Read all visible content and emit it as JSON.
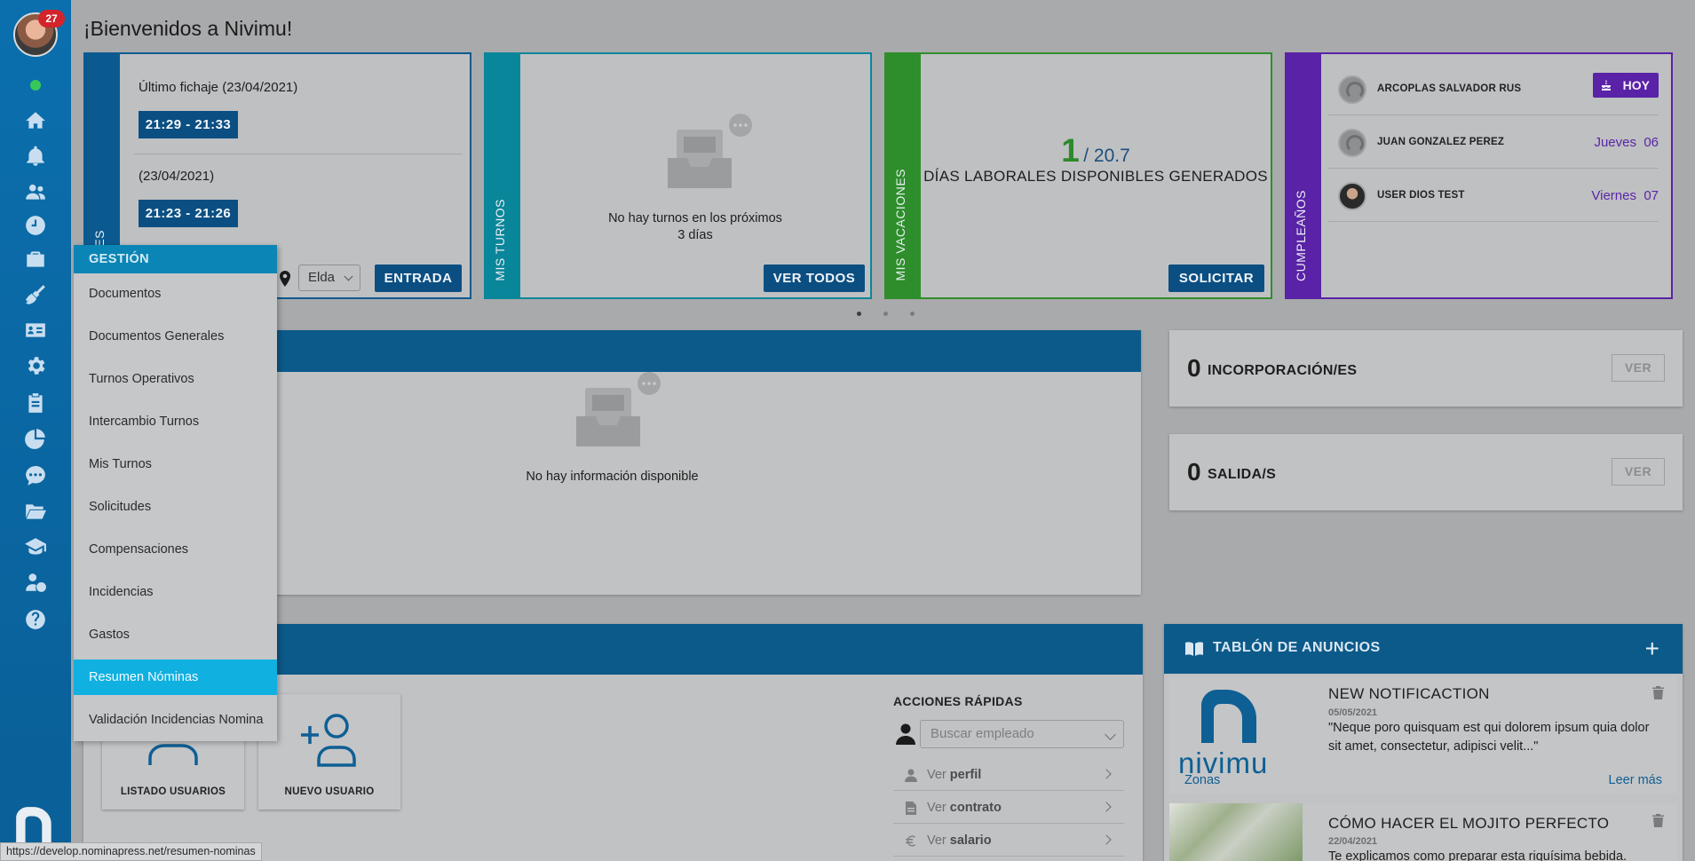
{
  "user": {
    "notification_count": "27"
  },
  "header": {
    "welcome": "¡Bienvenidos a Nivimu!"
  },
  "rail": {
    "icons": [
      "home-icon",
      "bell-icon",
      "users-icon",
      "clock-icon",
      "briefcase-icon",
      "broom-icon",
      "id-card-icon",
      "gear-icon",
      "clipboard-icon",
      "pie-chart-icon",
      "chat-icon",
      "folder-icon",
      "graduation-cap-icon",
      "user-salary-icon",
      "help-icon"
    ]
  },
  "fichajes": {
    "strip_label": "CHAJES",
    "entries": [
      {
        "title": "Último fichaje (23/04/2021)",
        "time": "21:29 - 21:33"
      },
      {
        "title": "(23/04/2021)",
        "time": "21:23 - 21:26"
      }
    ],
    "location": "Elda",
    "entry_button": "ENTRADA"
  },
  "turnos": {
    "strip_label": "MIS TURNOS",
    "empty_line1": "No hay turnos en los próximos",
    "empty_line2": "3 días",
    "button": "VER TODOS"
  },
  "vacaciones": {
    "strip_label": "MIS VACACIONES",
    "available": "1",
    "total": "/ 20.7",
    "label": "DÍAS LABORALES DISPONIBLES GENERADOS",
    "button": "SOLICITAR"
  },
  "cumpleanos": {
    "strip_label": "CUMPLEAÑOS",
    "rows": [
      {
        "name": "ARCOPLAS SALVADOR RUS",
        "date": "HOY"
      },
      {
        "name": "JUAN GONZALEZ PEREZ",
        "date": "Jueves  06"
      },
      {
        "name": "USER DIOS TEST",
        "date": "Viernes  07"
      }
    ]
  },
  "info_panel": {
    "empty_text": "No hay información disponible"
  },
  "incorporaciones": {
    "count": "0",
    "label": "INCORPORACIÓN/ES",
    "button": "VER"
  },
  "salidas": {
    "count": "0",
    "label": "SALIDA/S",
    "button": "VER"
  },
  "users_panel": {
    "tiles": [
      {
        "label": "LISTADO USUARIOS"
      },
      {
        "label": "NUEVO USUARIO"
      }
    ],
    "quick_actions": {
      "title": "ACCIONES RÁPIDAS",
      "search_placeholder": "Buscar empleado",
      "rows": [
        {
          "prefix": "Ver",
          "bold": "perfil"
        },
        {
          "prefix": "Ver",
          "bold": "contrato"
        },
        {
          "prefix": "Ver",
          "bold": "salario"
        }
      ]
    }
  },
  "anuncios": {
    "title": "TABLÓN DE ANUNCIOS",
    "items": [
      {
        "title": "NEW NOTIFICACTION",
        "date": "05/05/2021",
        "body": "\"Neque poro quisquam est qui dolorem ipsum quia dolor sit amet, consectetur, adipisci velit...\"",
        "zone_link": "Zonas",
        "more_link": "Leer más",
        "logo_text": "nivimu"
      },
      {
        "title": "CÓMO HACER EL MOJITO PERFECTO",
        "date": "22/04/2021",
        "body": "Te explicamos como preparar esta riquísima bebida."
      }
    ]
  },
  "menu": {
    "header": "GESTIÓN",
    "items": [
      "Documentos",
      "Documentos Generales",
      "Turnos Operativos",
      "Intercambio Turnos",
      "Mis Turnos",
      "Solicitudes",
      "Compensaciones",
      "Incidencias",
      "Gastos",
      "Resumen Nóminas",
      "Validación Incidencias Nomina"
    ],
    "active": "Resumen Nóminas"
  },
  "status_url": "https://develop.nominapress.net/resumen-nominas",
  "colors": {
    "rail": "#0b6fae",
    "fichajes": "#0b5a8f",
    "turnos": "#09869a",
    "vacaciones": "#2e8e2b",
    "cumpleanos": "#5a22a6",
    "menu_active": "#10b0e1"
  }
}
